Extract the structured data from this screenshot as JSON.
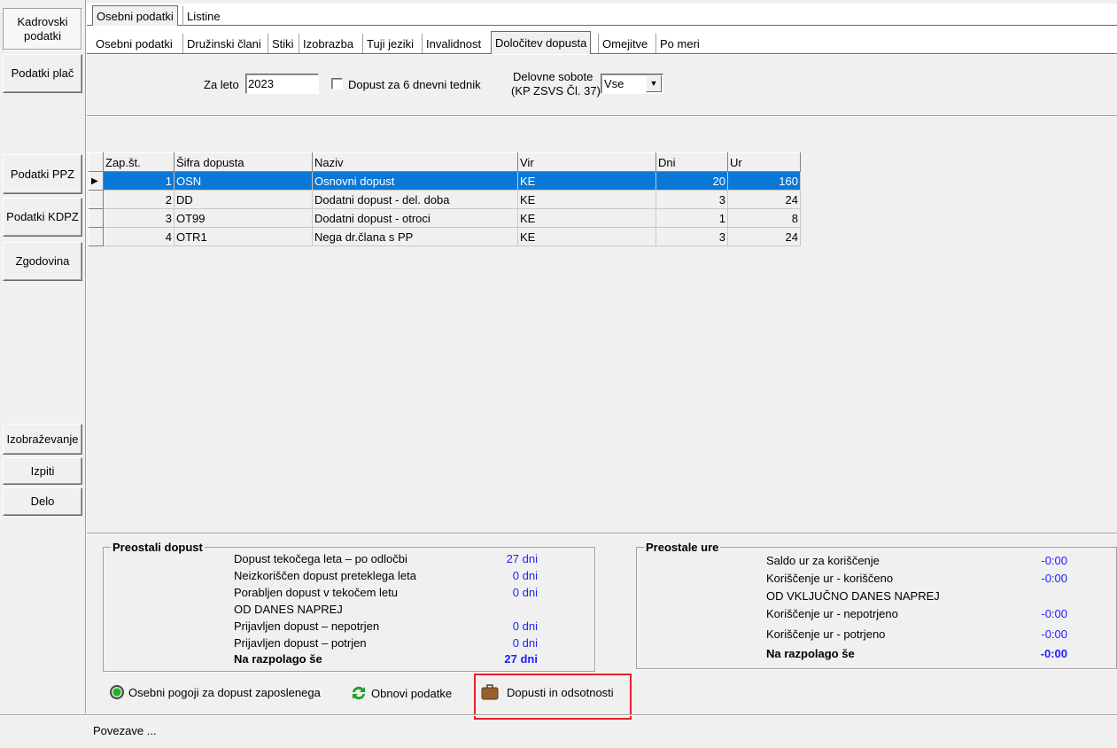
{
  "sidebar": {
    "items": [
      {
        "label": "Kadrovski podatki",
        "active": true
      },
      {
        "label": "Podatki plač"
      },
      {
        "label": "Podatki PPZ"
      },
      {
        "label": "Podatki KDPZ"
      },
      {
        "label": "Zgodovina"
      },
      {
        "label": "Izobraževanje"
      },
      {
        "label": "Izpiti"
      },
      {
        "label": "Delo"
      }
    ]
  },
  "top_tabs": [
    "Osebni podatki",
    "Listine"
  ],
  "sub_tabs": [
    "Osebni podatki",
    "Družinski člani",
    "Stiki",
    "Izobrazba",
    "Tuji jeziki",
    "Invalidnost",
    "Določitev dopusta",
    "Omejitve",
    "Po meri"
  ],
  "form": {
    "year_label": "Za leto",
    "year_value": "2023",
    "six_day_label": "Dopust za 6 dnevni tednik",
    "six_day_checked": false,
    "saturdays_label_1": "Delovne sobote",
    "saturdays_label_2": "(KP ZSVS Čl. 37)",
    "saturdays_value": "Vse"
  },
  "grid": {
    "columns": [
      "Zap.št.",
      "Šifra dopusta",
      "Naziv",
      "Vir",
      "Dni",
      "Ur"
    ],
    "rows": [
      [
        "1",
        "OSN",
        "Osnovni dopust",
        "KE",
        "20",
        "160"
      ],
      [
        "2",
        "DD",
        "Dodatni dopust - del. doba",
        "KE",
        "3",
        "24"
      ],
      [
        "3",
        "OT99",
        "Dodatni dopust - otroci",
        "KE",
        "1",
        "8"
      ],
      [
        "4",
        "OTR1",
        "Nega dr.člana s PP",
        "KE",
        "3",
        "24"
      ]
    ]
  },
  "left_group": {
    "title": "Preostali dopust",
    "rows": [
      {
        "label": "Dopust tekočega leta – po odločbi",
        "value": "27 dni"
      },
      {
        "label": "Neizkoriščen dopust preteklega leta",
        "value": "0 dni"
      },
      {
        "label": "Porabljen dopust v tekočem letu",
        "value": "0 dni"
      },
      {
        "label": "OD DANES NAPREJ",
        "value": ""
      },
      {
        "label": "Prijavljen dopust – nepotrjen",
        "value": "0 dni"
      },
      {
        "label": "Prijavljen dopust – potrjen",
        "value": "0 dni"
      },
      {
        "label": "Na razpolago še",
        "value": "27 dni"
      }
    ]
  },
  "right_group": {
    "title": "Preostale ure",
    "rows": [
      {
        "label": "Saldo ur za koriščenje",
        "value": "-0:00"
      },
      {
        "label": "Koriščenje ur - koriščeno",
        "value": "-0:00"
      },
      {
        "label": "OD VKLJUČNO DANES NAPREJ",
        "value": ""
      },
      {
        "label": "Koriščenje ur - nepotrjeno",
        "value": "-0:00"
      },
      {
        "label": "Koriščenje ur - potrjeno",
        "value": "-0:00"
      },
      {
        "label": "Na razpolago še",
        "value": "-0:00"
      }
    ]
  },
  "links": {
    "conditions": "Osebni pogoji za dopust zaposlenega",
    "refresh": "Obnovi podatke",
    "absences": "Dopusti in odsotnosti"
  },
  "status": {
    "links_label": "Povezave ..."
  },
  "colors": {
    "selection": "#0a78d7",
    "value_blue": "#2020ff",
    "highlight_box": "#e8202a"
  }
}
